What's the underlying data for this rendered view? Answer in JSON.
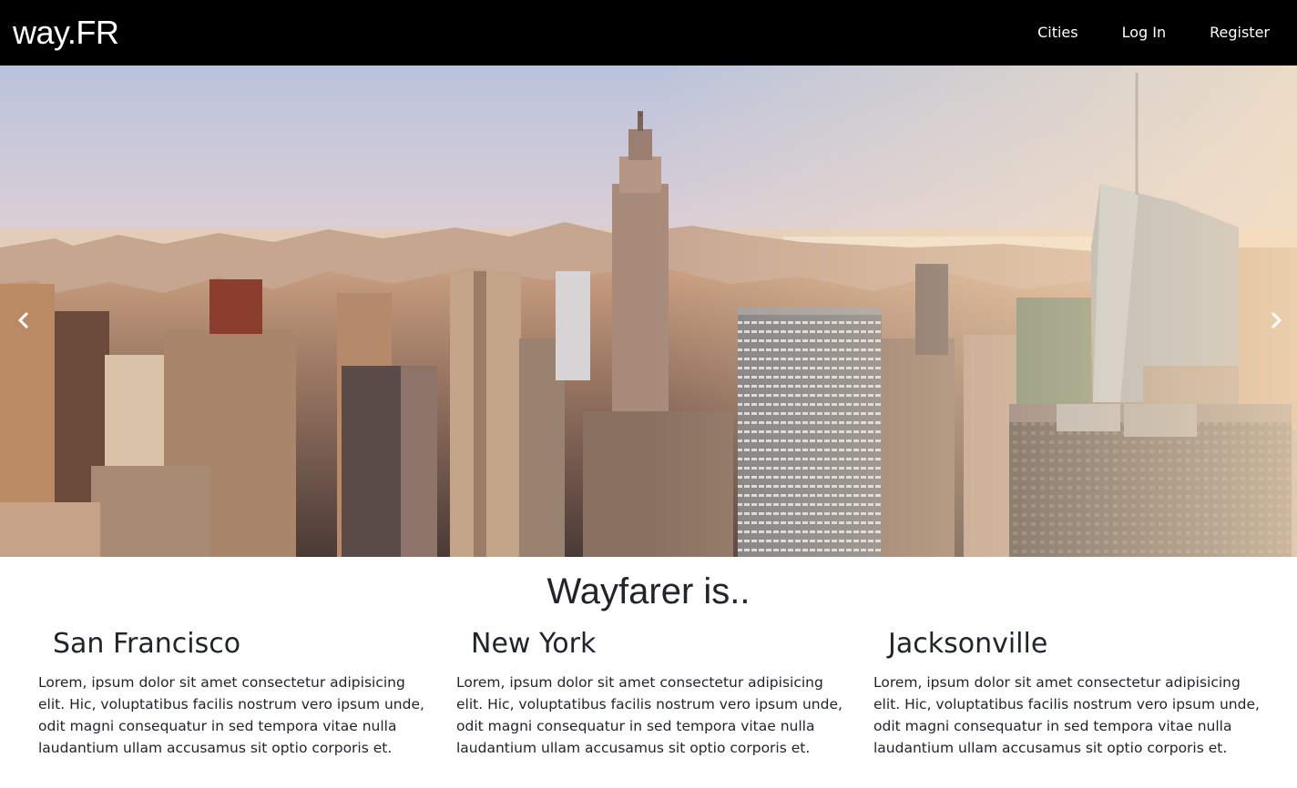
{
  "navbar": {
    "brand": "way.FR",
    "links": [
      {
        "label": "Cities"
      },
      {
        "label": "Log In"
      },
      {
        "label": "Register"
      }
    ]
  },
  "hero": {
    "prev_icon": "chevron-left-icon",
    "next_icon": "chevron-right-icon"
  },
  "main": {
    "title": "Wayfarer is..",
    "cities": [
      {
        "name": "San Francisco",
        "description": "Lorem, ipsum dolor sit amet consectetur adipisicing elit. Hic, voluptatibus facilis nostrum vero ipsum unde, odit magni consequatur in sed tempora vitae nulla laudantium ullam accusamus sit optio corporis et."
      },
      {
        "name": "New York",
        "description": "Lorem, ipsum dolor sit amet consectetur adipisicing elit. Hic, voluptatibus facilis nostrum vero ipsum unde, odit magni consequatur in sed tempora vitae nulla laudantium ullam accusamus sit optio corporis et."
      },
      {
        "name": "Jacksonville",
        "description": "Lorem, ipsum dolor sit amet consectetur adipisicing elit. Hic, voluptatibus facilis nostrum vero ipsum unde, odit magni consequatur in sed tempora vitae nulla laudantium ullam accusamus sit optio corporis et."
      }
    ]
  },
  "colors": {
    "navbar_bg": "#000000",
    "nav_text": "#ffffff",
    "body_text": "#212529"
  }
}
